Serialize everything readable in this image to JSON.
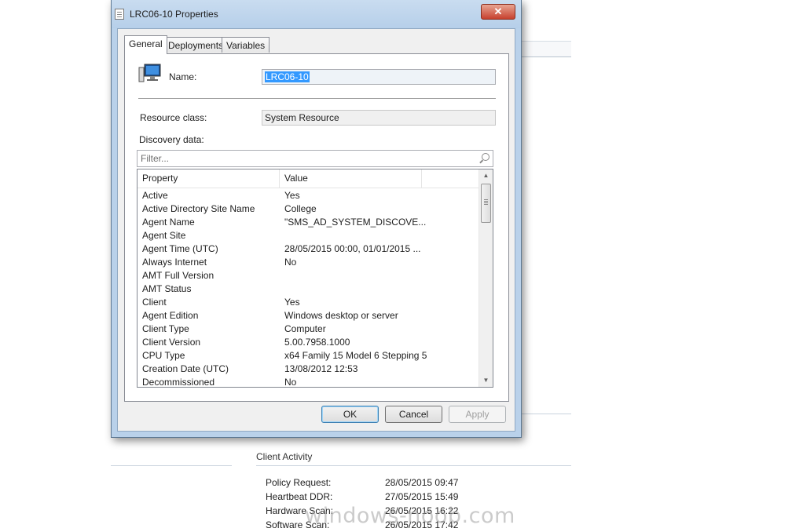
{
  "dialog": {
    "title": "LRC06-10 Properties",
    "close_glyph": "✕",
    "tabs": [
      {
        "label": "General"
      },
      {
        "label": "Deployments"
      },
      {
        "label": "Variables"
      }
    ],
    "name_label": "Name:",
    "name_value": "LRC06-10",
    "resource_class_label": "Resource class:",
    "resource_class_value": "System Resource",
    "discovery_label": "Discovery data:",
    "filter_placeholder": "Filter...",
    "columns": [
      "Property",
      "Value"
    ],
    "rows": [
      {
        "property": "Active",
        "value": "Yes"
      },
      {
        "property": "Active Directory Site Name",
        "value": "College"
      },
      {
        "property": "Agent Name",
        "value": "\"SMS_AD_SYSTEM_DISCOVE..."
      },
      {
        "property": "Agent Site",
        "value": ""
      },
      {
        "property": "Agent Time (UTC)",
        "value": "28/05/2015 00:00, 01/01/2015 ..."
      },
      {
        "property": "Always Internet",
        "value": "No"
      },
      {
        "property": "AMT Full Version",
        "value": ""
      },
      {
        "property": "AMT Status",
        "value": ""
      },
      {
        "property": "Client",
        "value": "Yes"
      },
      {
        "property": "Agent Edition",
        "value": "Windows desktop or server"
      },
      {
        "property": "Client Type",
        "value": "Computer"
      },
      {
        "property": "Client Version",
        "value": "5.00.7958.1000"
      },
      {
        "property": "CPU Type",
        "value": "x64 Family 15 Model 6 Stepping 5"
      },
      {
        "property": "Creation Date (UTC)",
        "value": "13/08/2012 12:53"
      },
      {
        "property": "Decommissioned",
        "value": "No"
      }
    ],
    "buttons": {
      "ok": "OK",
      "cancel": "Cancel",
      "apply": "Apply"
    }
  },
  "background": {
    "section_title": "Client Activity",
    "activity": [
      {
        "label": "Policy Request:",
        "value": "28/05/2015 09:47"
      },
      {
        "label": "Heartbeat DDR:",
        "value": "27/05/2015 15:49"
      },
      {
        "label": "Hardware Scan:",
        "value": "26/05/2015 16:22"
      },
      {
        "label": "Software Scan:",
        "value": "26/05/2015 17:42"
      }
    ],
    "watermark": "windows-noob.com"
  }
}
